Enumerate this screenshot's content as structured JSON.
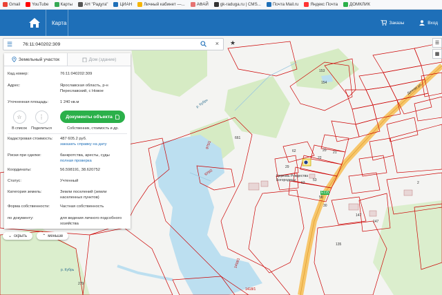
{
  "bookmarks": [
    {
      "label": "Gmail",
      "color": "#ea4335"
    },
    {
      "label": "YouTube",
      "color": "#ff0000"
    },
    {
      "label": "Карты",
      "color": "#34a853"
    },
    {
      "label": "АН \"Радуга\"",
      "color": "#555555"
    },
    {
      "label": "ЦИАН",
      "color": "#1e6fb8"
    },
    {
      "label": "Личный кабинет —...",
      "color": "#f5b400"
    },
    {
      "label": "АФАЙ",
      "color": "#e57373"
    },
    {
      "label": "gk-raduga.ru | CMS...",
      "color": "#333333"
    },
    {
      "label": "Почта Mail.ru",
      "color": "#1e6fb8"
    },
    {
      "label": "Яндекс Почта",
      "color": "#ff3333"
    },
    {
      "label": "ДОМКЛИК",
      "color": "#2bb04a"
    }
  ],
  "nav": {
    "title": "Карта",
    "orders": "Заказы",
    "login": "Вход"
  },
  "search": {
    "value": "76:11:040202:309"
  },
  "panel": {
    "tab_land": "Земельный участок",
    "tab_house": "Дом (здание)",
    "cad_label": "Кад.номер:",
    "cad_value": "76:11:040202:309",
    "addr_label": "Адрес:",
    "addr_value": "Ярославская область, р-н Переславский, с Новое",
    "area_label": "Уточненная площадь:",
    "area_value": "1 240 кв.м",
    "action_list": "В список",
    "action_share": "Поделиться",
    "doc_button": "Документы объекта",
    "doc_sub": "Собственник, стоимость и др.",
    "cost_label": "Кадастровая стоимость:",
    "cost_value": "487 605.2 руб.",
    "cost_link": "заказать справку на дату",
    "risk_label": "Риски при сделке:",
    "risk_value": "банкротства, аресты, суды",
    "risk_link": "полная проверка",
    "coords_label": "Координаты:",
    "coords_value": "56.598191, 38.620752",
    "status_label": "Статус:",
    "status_value": "Учтенный",
    "category_label": "Категория земель:",
    "category_value": "Земли поселений (земли населенных пунктов)",
    "ownership_label": "Форма собственности:",
    "ownership_value": "Частная собственность",
    "use_label": "по документу:",
    "use_value": "для ведения личного подсобного хозяйства"
  },
  "collapse": {
    "hide": "скрыть",
    "less": "меньше"
  },
  "map_labels": {
    "parcel_661": "661",
    "parcel_153": "153",
    "parcel_154": "154",
    "parcel_62": "62",
    "parcel_62b": "62",
    "parcel_135": "135",
    "parcel_147": "147",
    "parcel_279": "279",
    "parcel_2": "2",
    "river": "р. Кубрь",
    "river2": "р. Кубрь",
    "road_label": "Е115",
    "church": "Церковь Рождества Богородицы",
    "street": "Дачная ул.",
    "street2": "1418/1",
    "p_975_1": "975/1",
    "p_975": "975/2",
    "p_1418": "1418/1",
    "n20": "20",
    "n22": "22",
    "n30": "30",
    "n53": "53",
    "n58": "58",
    "n29": "29",
    "n147": "147",
    "n21": "21"
  },
  "colors": {
    "brand": "#1e6fb8",
    "doc_button": "#2bb04a",
    "parcel_stroke": "#cc0000",
    "water": "#bcdff0",
    "forest": "#d6ebc4"
  }
}
